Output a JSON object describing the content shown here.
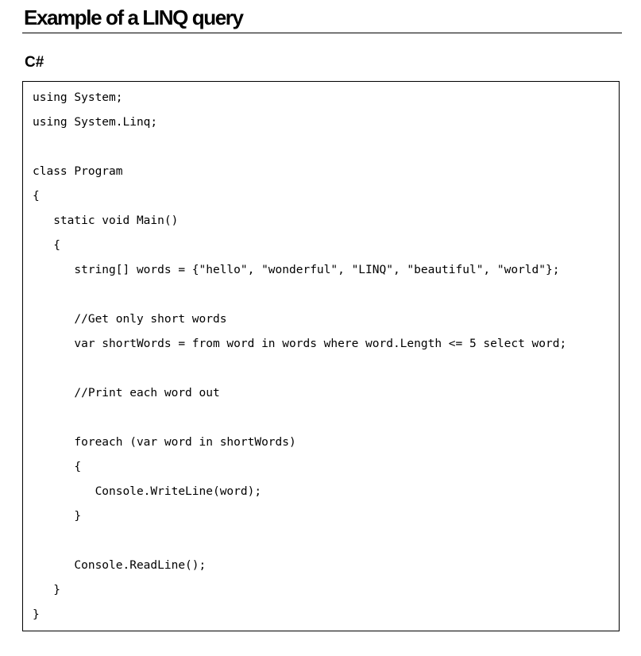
{
  "document": {
    "title": "Example of a LINQ query",
    "section_heading": "C#",
    "code_lines": [
      "using System;",
      "using System.Linq;",
      "",
      "class Program",
      "{",
      "   static void Main()",
      "   {",
      "      string[] words = {\"hello\", \"wonderful\", \"LINQ\", \"beautiful\", \"world\"};",
      "",
      "      //Get only short words",
      "      var shortWords = from word in words where word.Length <= 5 select word;",
      "",
      "      //Print each word out",
      "",
      "      foreach (var word in shortWords)",
      "      {",
      "         Console.WriteLine(word);",
      "      }",
      "",
      "      Console.ReadLine();",
      "   }",
      "}"
    ]
  }
}
